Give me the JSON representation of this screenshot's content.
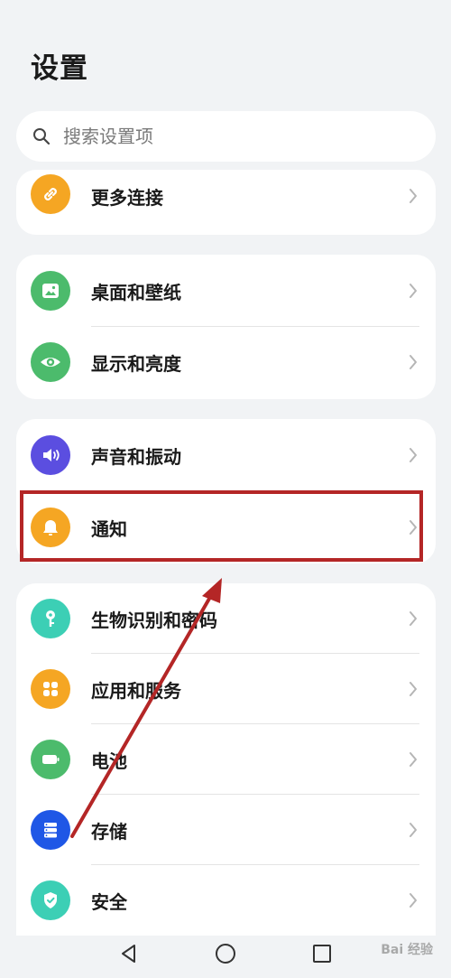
{
  "page_title": "设置",
  "search": {
    "placeholder": "搜索设置项"
  },
  "rows": {
    "more_connections": "更多连接",
    "desktop_wallpaper": "桌面和壁纸",
    "display_brightness": "显示和亮度",
    "sound_vibration": "声音和振动",
    "notifications": "通知",
    "biometrics_password": "生物识别和密码",
    "apps_services": "应用和服务",
    "battery": "电池",
    "storage": "存储",
    "security": "安全"
  },
  "icons": {
    "more_connections": "link-icon",
    "desktop_wallpaper": "wallpaper-icon",
    "display_brightness": "eye-icon",
    "sound_vibration": "speaker-icon",
    "notifications": "bell-icon",
    "biometrics_password": "key-icon",
    "apps_services": "grid-icon",
    "battery": "battery-icon",
    "storage": "storage-icon",
    "security": "shield-icon"
  },
  "colors": {
    "orange": "#f5a623",
    "green": "#4cbb6c",
    "purple": "#5b4ee0",
    "teal": "#3ccfb5",
    "blue": "#1f57e6",
    "annotation_red": "#b42626"
  },
  "watermark": "Bai 经验"
}
